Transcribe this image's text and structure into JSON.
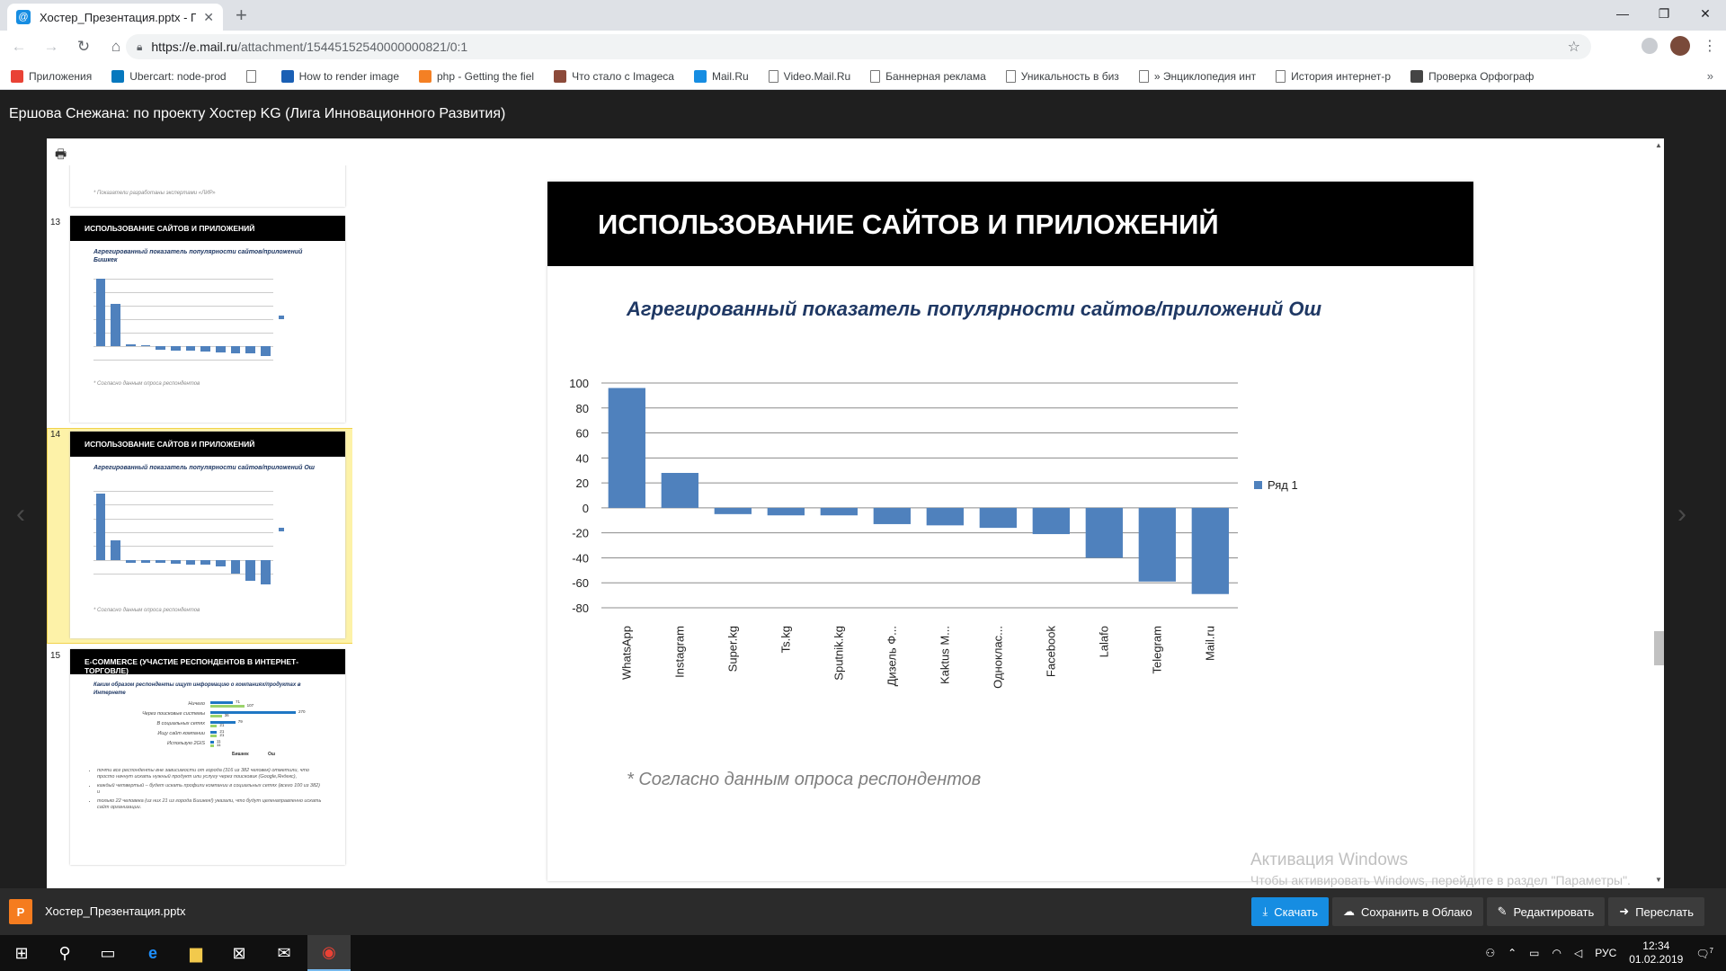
{
  "browser": {
    "tab_title": "Хостер_Презентация.pptx - По...",
    "tab_favicon": "@",
    "url_host": "https://e.mail.ru",
    "url_path": "/attachment/15445152540000000821/0:1"
  },
  "bookmarks": [
    {
      "label": "Приложения",
      "icon": "apps-grid-icon",
      "color": "#e94235"
    },
    {
      "label": "Ubercart: node-prod",
      "icon": "drupal-icon",
      "color": "#0678be"
    },
    {
      "label": "",
      "icon": "page-icon",
      "color": ""
    },
    {
      "label": "How to render image",
      "icon": "b-icon",
      "color": "#1a5fb4"
    },
    {
      "label": "php - Getting the fiel",
      "icon": "stack-icon",
      "color": "#f48024"
    },
    {
      "label": "Что стало с Imageca",
      "icon": "imageca-icon",
      "color": "#8c4a3a"
    },
    {
      "label": "Mail.Ru",
      "icon": "mailru-icon",
      "color": "#168de2"
    },
    {
      "label": "Video.Mail.Ru",
      "icon": "page-icon",
      "color": ""
    },
    {
      "label": "Баннерная реклама",
      "icon": "page-icon",
      "color": ""
    },
    {
      "label": "Уникальность в биз",
      "icon": "page-icon",
      "color": ""
    },
    {
      "label": "» Энциклопедия инт",
      "icon": "page-icon",
      "color": ""
    },
    {
      "label": "История интернет-р",
      "icon": "page-icon",
      "color": ""
    },
    {
      "label": "Проверка Орфограф",
      "icon": "check-icon",
      "color": "#444"
    }
  ],
  "viewer": {
    "title": "Ершова Снежана: по проекту Хостер KG (Лига Инновационного Развития)"
  },
  "thumbnails": [
    {
      "num": "",
      "note": "* Показатели разработаны экспертами «ЛИР»"
    },
    {
      "num": "13",
      "head": "ИСПОЛЬЗОВАНИЕ САЙТОВ И ПРИЛОЖЕНИЙ",
      "sub": "Агрегированный показатель популярности сайтов/приложений Бишкек",
      "note": "* Согласно данным опроса респондентов"
    },
    {
      "num": "14",
      "head": "ИСПОЛЬЗОВАНИЕ САЙТОВ И ПРИЛОЖЕНИЙ",
      "sub": "Агрегированный показатель популярности сайтов/приложений Ош",
      "note": "* Согласно данным опроса респондентов"
    },
    {
      "num": "15",
      "head": "E-COMMERCE (УЧАСТИЕ РЕСПОНДЕНТОВ В ИНТЕРНЕТ-ТОРГОВЛЕ)",
      "sub": "Каким образом респонденты ищут информацию о компаниях/продуктах в Интернете"
    }
  ],
  "thumb13_values": [
    100,
    63,
    3,
    2,
    -5,
    -6,
    -7,
    -8,
    -9,
    -10,
    -11,
    -15
  ],
  "thumb14_values": [
    96,
    28,
    -4,
    -5,
    -5,
    -6,
    -7,
    -7,
    -10,
    -20,
    -30,
    -36
  ],
  "thumb15": {
    "rows": [
      "Ничего",
      "Через поисковые системы",
      "В социальных сетях",
      "Ищу сайт компании",
      "Использую 2GIS"
    ],
    "bish": [
      71,
      270,
      79,
      21,
      11
    ],
    "osh": [
      107,
      36,
      21,
      21,
      11
    ],
    "legend": [
      "Бишкек",
      "Ош"
    ],
    "bullets": [
      "почти все респонденты вне зависимости от города (316 из 382 человек) отметили, что просто начнут искать нужный продукт или услугу через поисковик (Google,Яндекс),",
      "каждый четвертый – будет искать профили компании в социальных сетях (всего 100 из 382) и",
      "только 22 человека (из них 21 из города Бишкек!) указали, что будут целенаправленно искать сайт организации."
    ]
  },
  "slide": {
    "title": "ИСПОЛЬЗОВАНИЕ САЙТОВ И ПРИЛОЖЕНИЙ",
    "subtitle": "Агрегированный показатель популярности сайтов/приложений Ош",
    "note": "* Согласно данным опроса респондентов"
  },
  "chart_data": {
    "type": "bar",
    "title": "",
    "xlabel": "",
    "ylabel": "",
    "categories": [
      "WhatsApp",
      "Instagram",
      "Super.kg",
      "Ts.kg",
      "Sputnik.kg",
      "Дизель Ф...",
      "Kaktus M...",
      "Одноклас...",
      "Facebook",
      "Lalafo",
      "Telegram",
      "Mail.ru"
    ],
    "series": [
      {
        "name": "Ряд 1",
        "values": [
          96,
          28,
          -5,
          -6,
          -6,
          -13,
          -14,
          -16,
          -21,
          -40,
          -59,
          -69
        ],
        "color": "#4f81bd"
      }
    ],
    "ylim": [
      -80,
      100
    ],
    "yticks": [
      100,
      80,
      60,
      40,
      20,
      0,
      -20,
      -40,
      -60,
      -80
    ],
    "grid": true,
    "legend_position": "right"
  },
  "watermark": {
    "line1": "Активация Windows",
    "line2": "Чтобы активировать Windows, перейдите в раздел \"Параметры\"."
  },
  "actionbar": {
    "file_name": "Хостер_Презентация.pptx",
    "file_letter": "P",
    "download": "Скачать",
    "save_cloud": "Сохранить в Облако",
    "edit": "Редактировать",
    "forward": "Переслать"
  },
  "taskbar": {
    "lang": "РУС",
    "time": "12:34",
    "date": "01.02.2019",
    "notif_count": "7"
  }
}
